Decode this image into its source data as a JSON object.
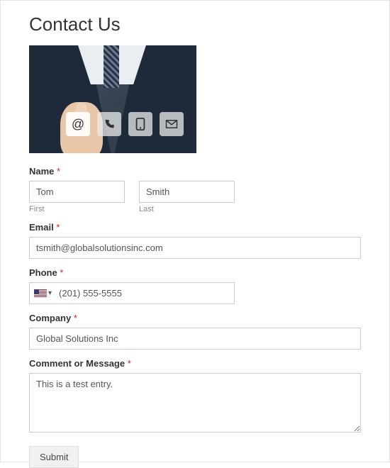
{
  "header": {
    "title": "Contact Us"
  },
  "hero": {
    "icons": [
      "at",
      "phone",
      "mobile",
      "mail"
    ],
    "selected": 0
  },
  "form": {
    "name": {
      "label": "Name",
      "required_marker": "*",
      "first": {
        "value": "Tom",
        "sublabel": "First"
      },
      "last": {
        "value": "Smith",
        "sublabel": "Last"
      }
    },
    "email": {
      "label": "Email",
      "required_marker": "*",
      "value": "tsmith@globalsolutionsinc.com"
    },
    "phone": {
      "label": "Phone",
      "required_marker": "*",
      "country": "US",
      "value": "(201) 555-5555"
    },
    "company": {
      "label": "Company",
      "required_marker": "*",
      "value": "Global Solutions Inc"
    },
    "message": {
      "label": "Comment or Message",
      "required_marker": "*",
      "value": "This is a test entry."
    },
    "submit_label": "Submit"
  }
}
